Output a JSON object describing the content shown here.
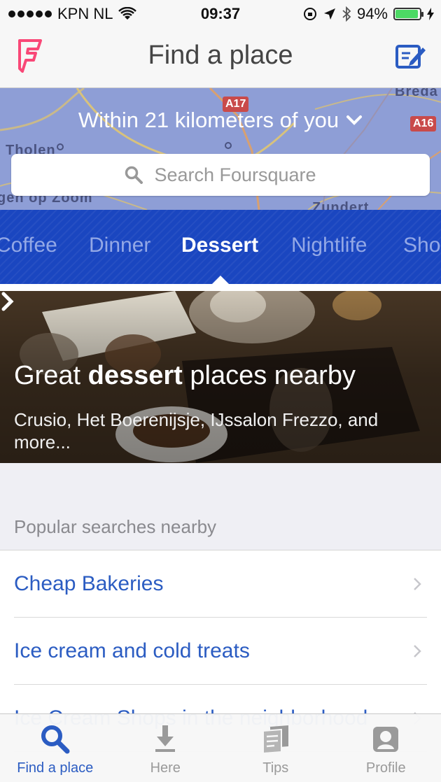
{
  "status_bar": {
    "carrier": "KPN NL",
    "time": "09:37",
    "battery": "94%",
    "battery_level": 0.94
  },
  "nav": {
    "title": "Find a place",
    "logo_icon": "foursquare-logo-icon",
    "compose_icon": "compose-icon"
  },
  "map": {
    "within_label": "Within 21 kilometers of you",
    "search_placeholder": "Search Foursquare",
    "labels": {
      "a17": "A17",
      "a16": "A16",
      "tholen": "Tholen",
      "breda": "Breda",
      "zoom": "gen op Zoom",
      "zundert": "Zundert"
    }
  },
  "categories": [
    {
      "label": "Coffee",
      "active": false
    },
    {
      "label": "Dinner",
      "active": false
    },
    {
      "label": "Dessert",
      "active": true
    },
    {
      "label": "Nightlife",
      "active": false
    },
    {
      "label": "Sho",
      "active": false
    }
  ],
  "feature": {
    "title_pre": "Great",
    "title_bold": "dessert",
    "title_post": "places nearby",
    "subtitle": "Crusio, Het Boerenijsje, IJssalon Frezzo, and more..."
  },
  "popular": {
    "heading": "Popular searches nearby",
    "items": [
      "Cheap Bakeries",
      "Ice cream and cold treats",
      "Ice Cream Shops in the neighborhood"
    ]
  },
  "tabs": [
    {
      "label": "Find a place",
      "icon": "search-icon",
      "active": true
    },
    {
      "label": "Here",
      "icon": "here-icon",
      "active": false
    },
    {
      "label": "Tips",
      "icon": "tips-icon",
      "active": false
    },
    {
      "label": "Profile",
      "icon": "profile-icon",
      "active": false
    }
  ],
  "colors": {
    "accent": "#2b5cc2",
    "category_bar": "#1a46c0",
    "logo": "#f94877"
  }
}
